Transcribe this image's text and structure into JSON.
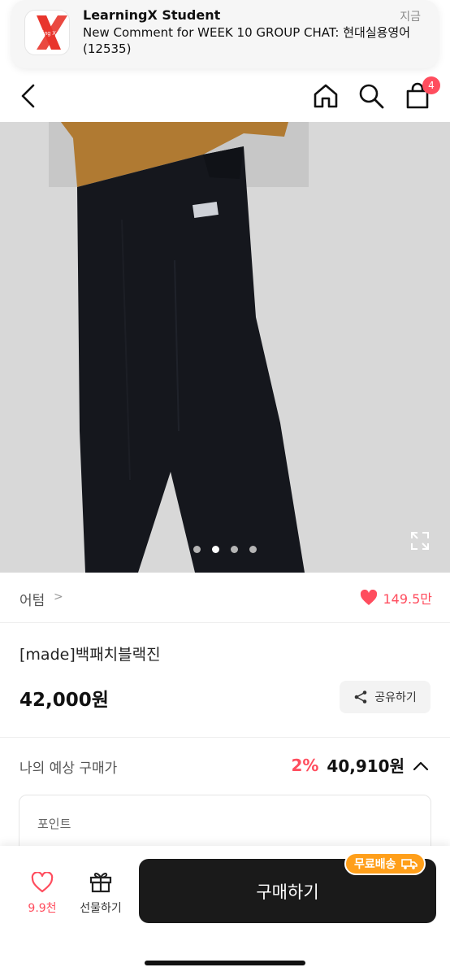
{
  "notification": {
    "app_name": "LearningX Student",
    "time": "지금",
    "message": "New Comment for WEEK 10 GROUP CHAT: 현대실용영어(12535)",
    "icon_text": "Learning X"
  },
  "header": {
    "cart_count": "4"
  },
  "gallery": {
    "total_images": 4,
    "active_index": 1
  },
  "product": {
    "brand": "어텀",
    "likes": "149.5만",
    "title": "[made]백패치블랙진",
    "price": "42,000원",
    "share_label": "공유하기"
  },
  "expected_price": {
    "label": "나의 예상 구매가",
    "discount": "2%",
    "price": "40,910원"
  },
  "points": {
    "label": "포인트"
  },
  "bottom_bar": {
    "wish_count": "9.9천",
    "gift_label": "선물하기",
    "buy_label": "구매하기",
    "free_shipping": "무료배송"
  },
  "colors": {
    "accent": "#ff4d5e",
    "badge_orange": "#ff9f1a",
    "buy_button": "#1a1a1a"
  }
}
